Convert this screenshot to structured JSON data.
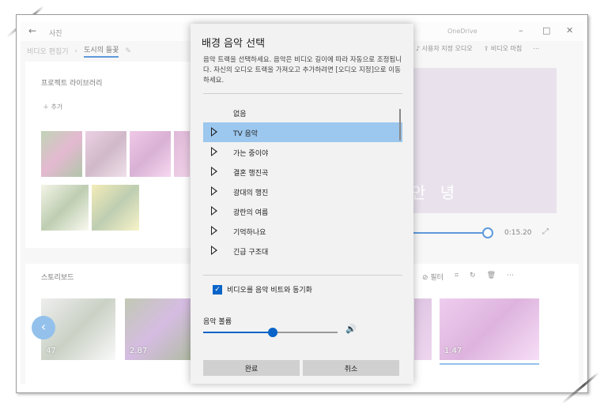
{
  "app": {
    "title": "사진",
    "onedrive": "OneDrive",
    "breadcrumb": [
      "비디오 편집기",
      "도시의 들꽃"
    ],
    "toolbar": {
      "custom_audio": "사용자 지정 오디오",
      "finish_video": "비디오 마침"
    },
    "library": {
      "title": "프로젝트 라이브러리",
      "add": "추가"
    },
    "preview": {
      "caption": "안 녕",
      "time": "0:15.20"
    },
    "storyboard": {
      "title": "스토리보드",
      "filter": "필터",
      "cards": [
        {
          "duration": "47"
        },
        {
          "duration": "2.87"
        },
        {
          "duration": "1.47"
        }
      ]
    }
  },
  "dialog": {
    "title": "배경 음악 선택",
    "description": "음악 트랙을 선택하세요. 음악은 비디오 길이에 따라 자동으로 조정됩니다. 자신의 오디오 트랙을 가져오고 추가하려면 [오디오 지정]으로 이동하세요.",
    "tracks": [
      "없음",
      "TV 음악",
      "가는 중이야",
      "결혼 행진곡",
      "광대의 행진",
      "광란의 여름",
      "기억하나요",
      "긴급 구조대"
    ],
    "selected_index": 1,
    "sync_label": "비디오를 음악 비트와 동기화",
    "sync_checked": true,
    "volume_label": "음악 볼륨",
    "volume_level": 0.52,
    "done": "완료",
    "cancel": "취소"
  },
  "colors": {
    "accent": "#0a64c8",
    "selection": "#9cc7ee"
  }
}
